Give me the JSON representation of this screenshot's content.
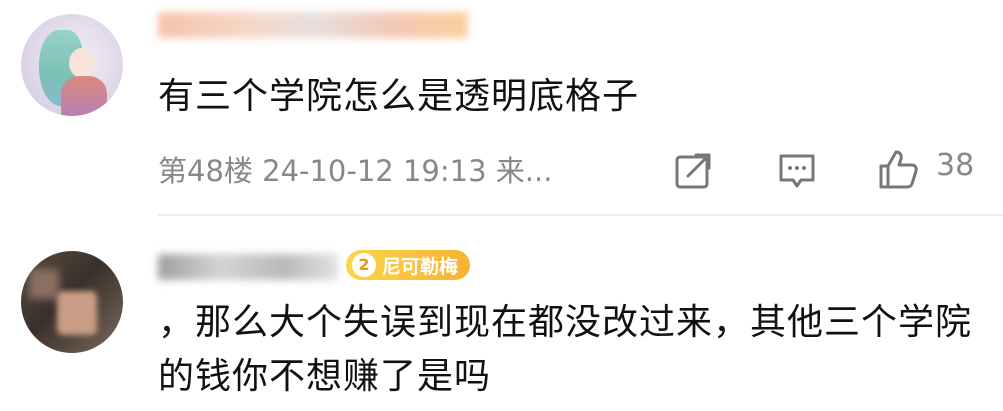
{
  "comments": [
    {
      "text": "有三个学院怎么是透明底格子",
      "meta": "第48楼 24-10-12 19:13 来...",
      "like_count": "38"
    },
    {
      "badge_level": "2",
      "badge_label": "尼可勒梅",
      "text": "，那么大个失误到现在都没改过来，其他三个学院的钱你不想赚了是吗"
    }
  ],
  "icons": {
    "share": "share-icon",
    "comment": "comment-icon",
    "like": "thumbs-up-icon"
  }
}
